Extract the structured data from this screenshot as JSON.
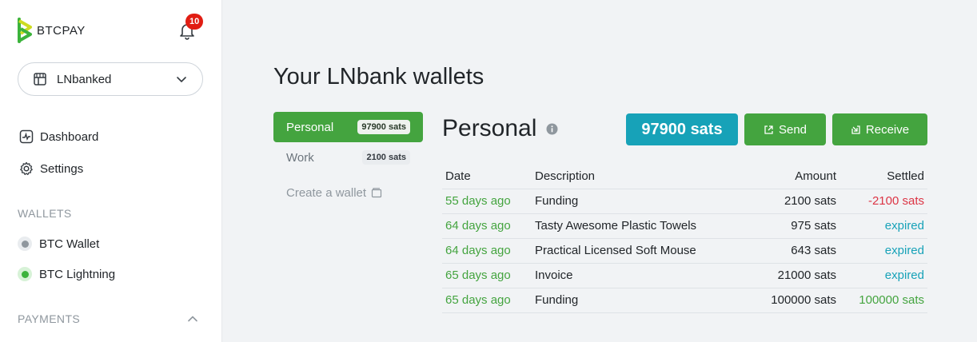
{
  "brand": {
    "name": "BTCPAY"
  },
  "notifications": {
    "count": "10"
  },
  "store": {
    "name": "LNbanked"
  },
  "nav": {
    "dashboard": "Dashboard",
    "settings": "Settings"
  },
  "sections": {
    "wallets": "WALLETS",
    "payments": "PAYMENTS"
  },
  "wallets": [
    {
      "label": "BTC Wallet",
      "status_color": "#8f979e"
    },
    {
      "label": "BTC Lightning",
      "status_color": "#3bb33b"
    }
  ],
  "page": {
    "title": "Your LNbank wallets"
  },
  "wallet_list": [
    {
      "name": "Personal",
      "balance": "97900 sats",
      "active": true
    },
    {
      "name": "Work",
      "balance": "2100 sats",
      "active": false
    }
  ],
  "create_wallet": "Create a wallet",
  "current_wallet": {
    "name": "Personal",
    "balance": "97900 sats",
    "send_label": "Send",
    "receive_label": "Receive"
  },
  "transactions": {
    "headers": {
      "date": "Date",
      "description": "Description",
      "amount": "Amount",
      "settled": "Settled"
    },
    "rows": [
      {
        "date": "55 days ago",
        "description": "Funding",
        "amount": "2100 sats",
        "settled": "-2100 sats",
        "status": "negative"
      },
      {
        "date": "64 days ago",
        "description": "Tasty Awesome Plastic Towels",
        "amount": "975 sats",
        "settled": "expired",
        "status": "expired"
      },
      {
        "date": "64 days ago",
        "description": "Practical Licensed Soft Mouse",
        "amount": "643 sats",
        "settled": "expired",
        "status": "expired"
      },
      {
        "date": "65 days ago",
        "description": "Invoice",
        "amount": "21000 sats",
        "settled": "expired",
        "status": "expired"
      },
      {
        "date": "65 days ago",
        "description": "Funding",
        "amount": "100000 sats",
        "settled": "100000 sats",
        "status": "positive"
      }
    ]
  },
  "colors": {
    "brand_green": "#44a43f",
    "info_teal": "#17a2b8",
    "danger_red": "#dc3545"
  }
}
